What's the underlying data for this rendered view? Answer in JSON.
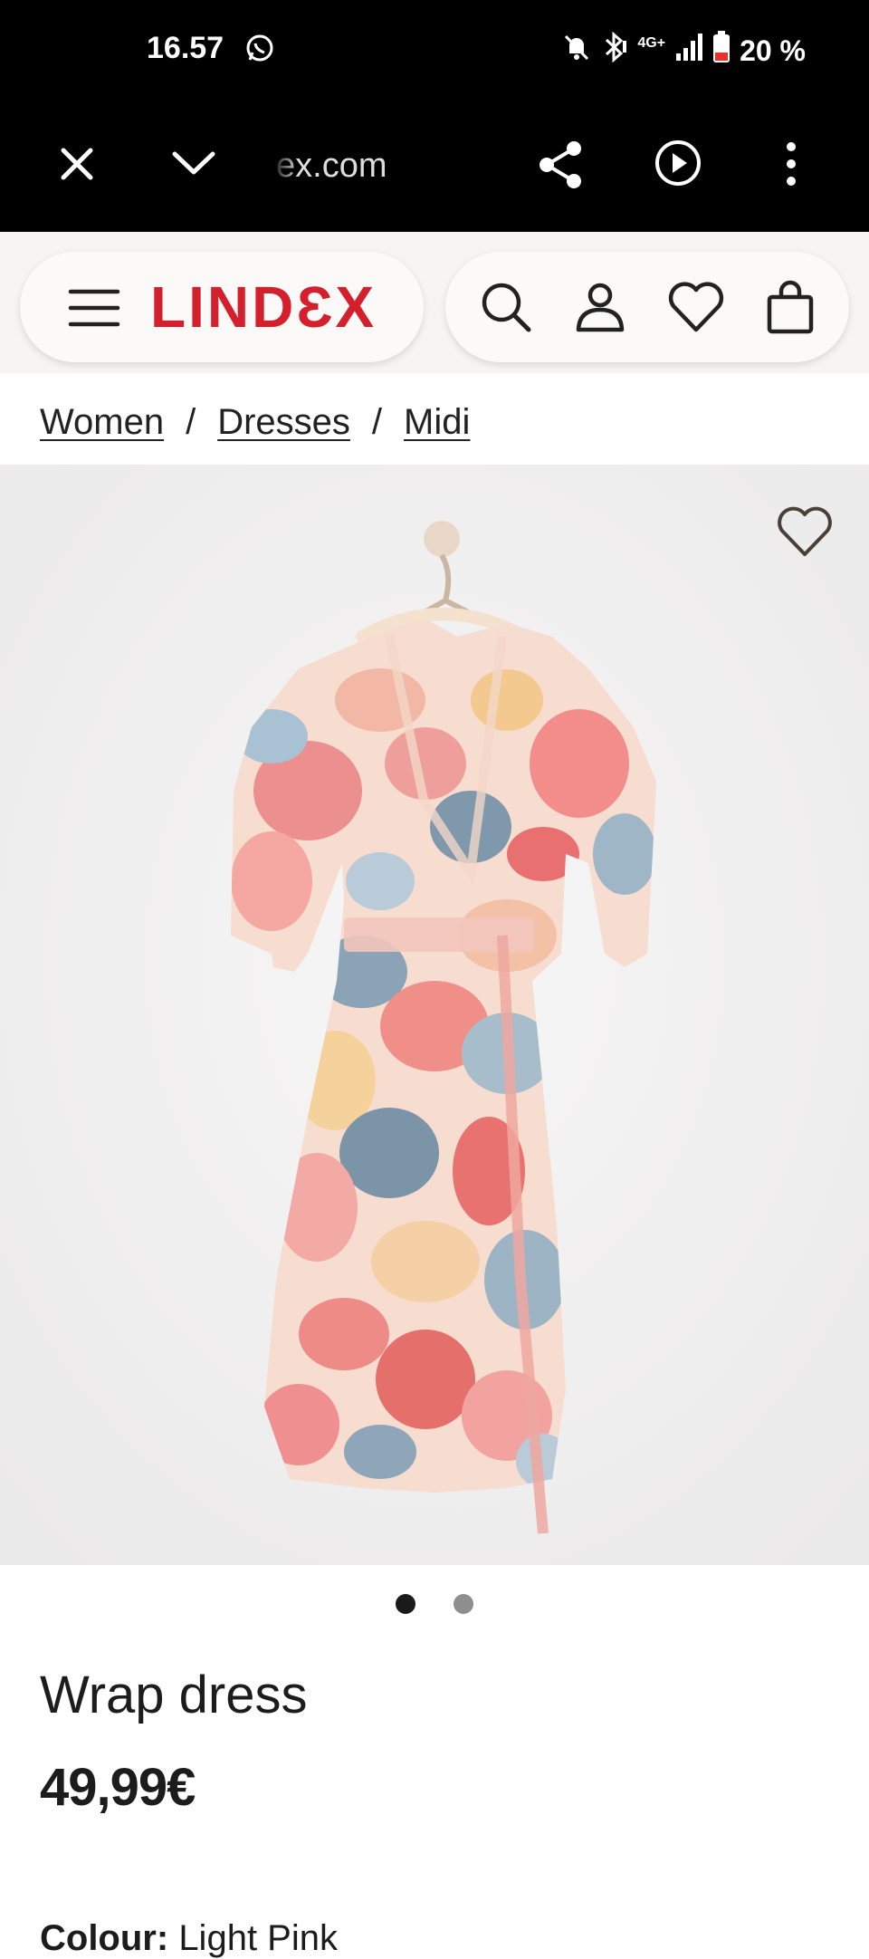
{
  "status_bar": {
    "time": "16.57",
    "network": "4G+",
    "battery": "20 %",
    "battery_color": "#e5322d"
  },
  "browser": {
    "url": "ex.com",
    "icons": [
      "close-icon",
      "chevron-down-icon",
      "share-icon",
      "play-icon",
      "more-vert-icon"
    ]
  },
  "header": {
    "logo": "LINDƐX",
    "brand_color": "#d4202c",
    "icons": [
      "menu-icon",
      "search-icon",
      "account-icon",
      "favorites-icon",
      "bag-icon"
    ]
  },
  "breadcrumb": {
    "items": [
      "Women",
      "Dresses",
      "Midi"
    ],
    "separator": "/"
  },
  "product": {
    "title": "Wrap dress",
    "price": "49,99€",
    "colour_label": "Colour:",
    "colour_value": "Light Pink",
    "image_count": 2,
    "active_image": 1
  }
}
